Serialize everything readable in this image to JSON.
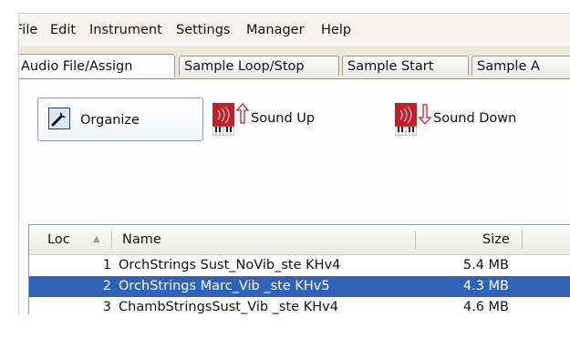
{
  "menu": [
    "File",
    "Edit",
    "Instrument",
    "Settings",
    "Manager",
    "Help"
  ],
  "tabs": [
    "Audio File/Assign",
    "Sample Loop/Stop",
    "Sample Start",
    "Sample A"
  ],
  "toolbar": {
    "organize_label": "Organize",
    "organize_icon": "wrench-icon",
    "sound_up_label": "Sound Up",
    "sound_down_label": "Sound Down",
    "keyboard_icon": "keyboard-icon",
    "accent_red": "#c0202a"
  },
  "list": {
    "columns": {
      "loc": "Loc",
      "name": "Name",
      "size": "Size"
    },
    "sort_indicator": "▲",
    "rows": [
      {
        "loc": "1",
        "name": "OrchStrings Sust_NoVib_ste KHv4",
        "size": "5.4 MB",
        "selected": false
      },
      {
        "loc": "2",
        "name": "OrchStrings Marc_Vib _ste KHv5",
        "size": "4.3 MB",
        "selected": true
      },
      {
        "loc": "3",
        "name": "ChambStringsSust_Vib _ste KHv4",
        "size": "4.6 MB",
        "selected": false
      }
    ]
  },
  "colors": {
    "selection": "#2f62b8",
    "background": "#ece9d8"
  }
}
